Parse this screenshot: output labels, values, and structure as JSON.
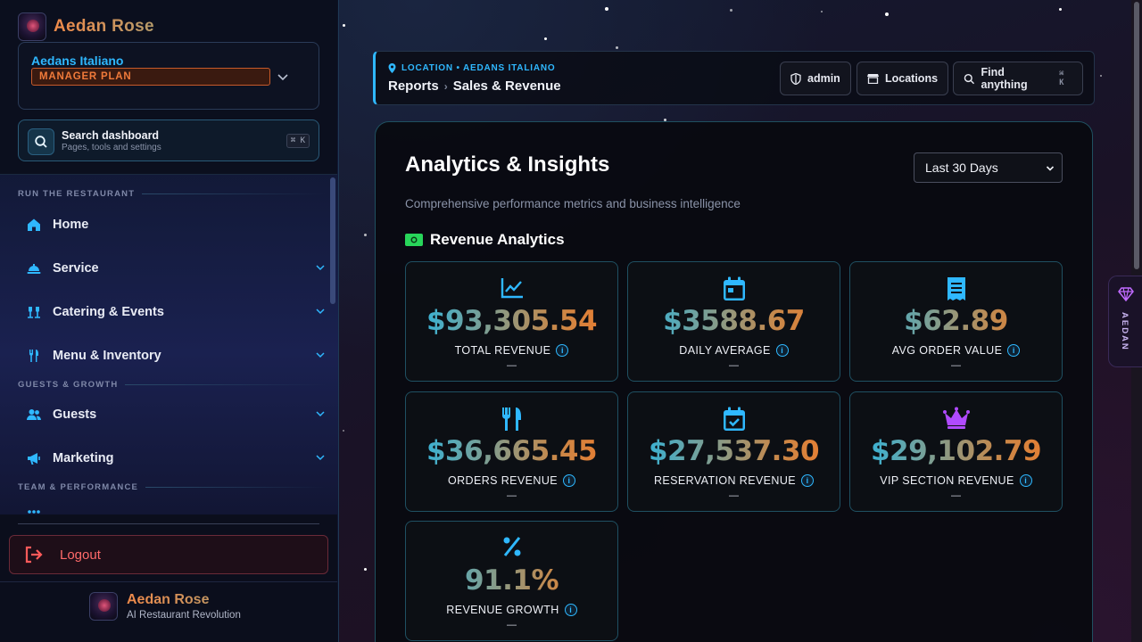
{
  "brand": {
    "name": "Aedan Rose",
    "logo_icon": "rose-logo-icon"
  },
  "location_card": {
    "name": "Aedans Italiano",
    "plan": "MANAGER PLAN"
  },
  "search_dashboard": {
    "title": "Search dashboard",
    "subtitle": "Pages, tools and settings",
    "shortcut": "⌘ K"
  },
  "nav": {
    "sections": [
      {
        "label": "RUN THE RESTAURANT"
      },
      {
        "label": "GUESTS & GROWTH"
      },
      {
        "label": "TEAM & PERFORMANCE"
      }
    ],
    "items": [
      {
        "label": "Home",
        "icon": "home-icon"
      },
      {
        "label": "Service",
        "icon": "service-bell-icon"
      },
      {
        "label": "Catering & Events",
        "icon": "catering-icon"
      },
      {
        "label": "Menu & Inventory",
        "icon": "utensils-icon"
      },
      {
        "label": "Guests",
        "icon": "users-icon"
      },
      {
        "label": "Marketing",
        "icon": "megaphone-icon"
      }
    ]
  },
  "logout": {
    "label": "Logout"
  },
  "footer": {
    "title": "Aedan Rose",
    "subtitle": "AI Restaurant Revolution"
  },
  "topbar": {
    "location": "LOCATION • AEDANS ITALIANO",
    "breadcrumb": [
      "Reports",
      "Sales & Revenue"
    ],
    "buttons": {
      "admin": "admin",
      "locations": "Locations",
      "find": "Find anything",
      "find_shortcut": "⌘ K"
    }
  },
  "analytics": {
    "title": "Analytics & Insights",
    "subtitle": "Comprehensive performance metrics and business intelligence",
    "period": "Last 30 Days",
    "section_title": "Revenue Analytics",
    "metrics": [
      {
        "value": "$93,305.54",
        "label": "TOTAL REVENUE",
        "delta": "—",
        "icon": "line-chart-icon"
      },
      {
        "value": "$3588.67",
        "label": "DAILY AVERAGE",
        "delta": "—",
        "icon": "calendar-icon"
      },
      {
        "value": "$62.89",
        "label": "AVG ORDER VALUE",
        "delta": "—",
        "icon": "receipt-icon"
      },
      {
        "value": "$36,665.45",
        "label": "ORDERS REVENUE",
        "delta": "—",
        "icon": "fork-knife-icon"
      },
      {
        "value": "$27,537.30",
        "label": "RESERVATION REVENUE",
        "delta": "—",
        "icon": "calendar-check-icon"
      },
      {
        "value": "$29,102.79",
        "label": "VIP SECTION REVENUE",
        "delta": "—",
        "icon": "crown-icon"
      },
      {
        "value": "91.1%",
        "label": "REVENUE GROWTH",
        "delta": "—",
        "icon": "percent-icon"
      }
    ]
  },
  "side_tab": {
    "label": "AEDAN"
  },
  "colors": {
    "accent": "#2fb8ff",
    "brand_orange": "#f08a4a",
    "logout_red": "#ff6a6a",
    "vip_purple": "#b04aff"
  }
}
